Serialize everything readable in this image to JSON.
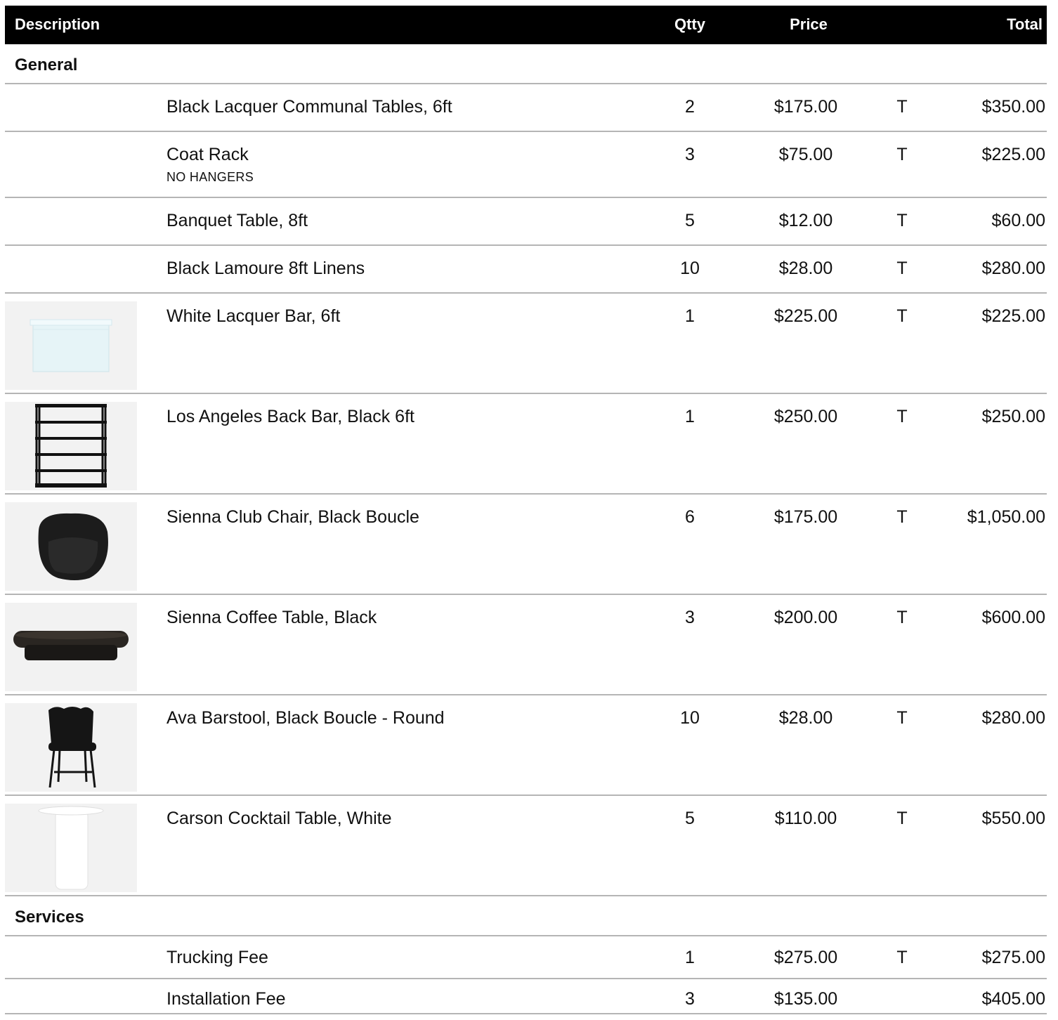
{
  "header": {
    "description": "Description",
    "qty": "Qtty",
    "price": "Price",
    "total": "Total"
  },
  "sections": [
    {
      "name": "General",
      "items": [
        {
          "description": "Black Lacquer Communal Tables, 6ft",
          "note": "",
          "qty": "2",
          "price": "$175.00",
          "tax": "T",
          "total": "$350.00",
          "image": ""
        },
        {
          "description": "Coat Rack",
          "note": "NO HANGERS",
          "qty": "3",
          "price": "$75.00",
          "tax": "T",
          "total": "$225.00",
          "image": ""
        },
        {
          "description": "Banquet Table, 8ft",
          "note": "",
          "qty": "5",
          "price": "$12.00",
          "tax": "T",
          "total": "$60.00",
          "image": ""
        },
        {
          "description": "Black Lamoure 8ft Linens",
          "note": "",
          "qty": "10",
          "price": "$28.00",
          "tax": "T",
          "total": "$280.00",
          "image": ""
        },
        {
          "description": "White Lacquer Bar, 6ft",
          "note": "",
          "qty": "1",
          "price": "$225.00",
          "tax": "T",
          "total": "$225.00",
          "image": "white-bar-photo"
        },
        {
          "description": "Los Angeles Back Bar, Black 6ft",
          "note": "",
          "qty": "1",
          "price": "$250.00",
          "tax": "T",
          "total": "$250.00",
          "image": "black-shelf-photo"
        },
        {
          "description": "Sienna Club Chair, Black Boucle",
          "note": "",
          "qty": "6",
          "price": "$175.00",
          "tax": "T",
          "total": "$1,050.00",
          "image": "club-chair-photo"
        },
        {
          "description": "Sienna Coffee Table, Black",
          "note": "",
          "qty": "3",
          "price": "$200.00",
          "tax": "T",
          "total": "$600.00",
          "image": "coffee-table-photo"
        },
        {
          "description": "Ava Barstool,  Black Boucle - Round",
          "note": "",
          "qty": "10",
          "price": "$28.00",
          "tax": "T",
          "total": "$280.00",
          "image": "barstool-photo"
        },
        {
          "description": "Carson Cocktail Table, White",
          "note": "",
          "qty": "5",
          "price": "$110.00",
          "tax": "T",
          "total": "$550.00",
          "image": "cocktail-table-photo"
        }
      ]
    },
    {
      "name": "Services",
      "items": [
        {
          "description": "Trucking Fee",
          "note": "",
          "qty": "1",
          "price": "$275.00",
          "tax": "T",
          "total": "$275.00",
          "image": ""
        },
        {
          "description": "Installation Fee",
          "note": "",
          "qty": "3",
          "price": "$135.00",
          "tax": "",
          "total": "$405.00",
          "image": ""
        }
      ]
    }
  ]
}
